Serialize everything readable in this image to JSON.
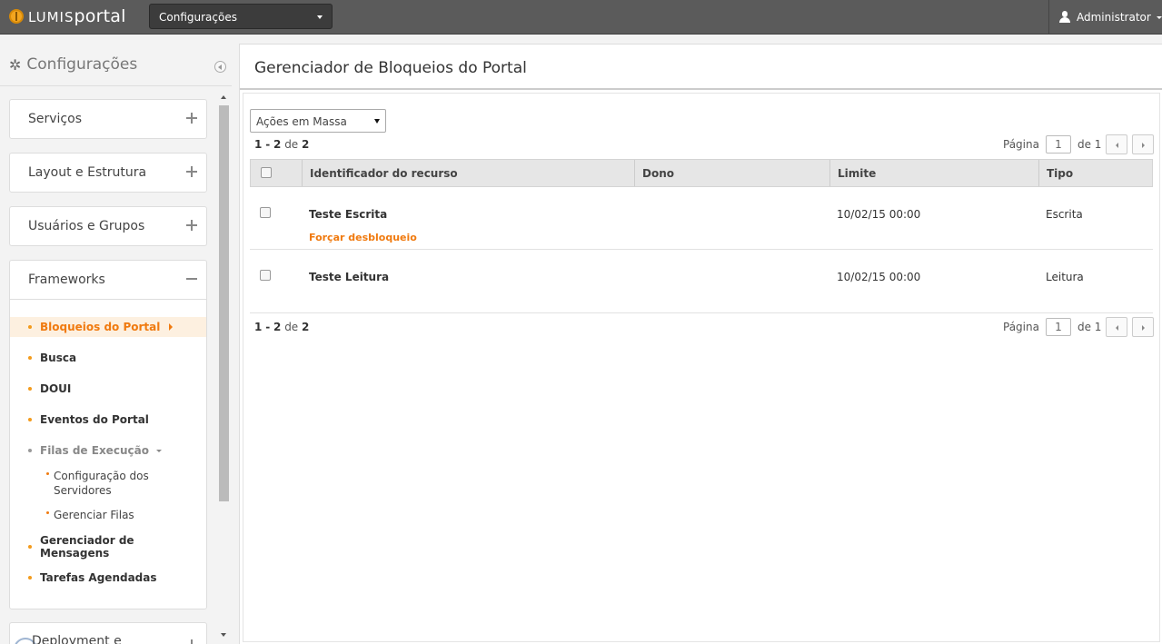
{
  "app": {
    "logo_text_a": "LUMIS",
    "logo_text_b": "portal",
    "context_select": "Configurações",
    "user": "Administrator"
  },
  "sidebar": {
    "title": "Configurações",
    "panels": [
      {
        "label": "Serviços"
      },
      {
        "label": "Layout e Estrutura"
      },
      {
        "label": "Usuários e Grupos"
      }
    ],
    "frameworks": {
      "label": "Frameworks",
      "items": [
        {
          "label": "Bloqueios do Portal"
        },
        {
          "label": "Busca"
        },
        {
          "label": "DOUI"
        },
        {
          "label": "Eventos do Portal"
        },
        {
          "label": "Filas de Execução"
        },
        {
          "label": "Gerenciador de Mensagens"
        },
        {
          "label": "Tarefas Agendadas"
        }
      ],
      "subitems": [
        {
          "label": "Configuração dos Servidores"
        },
        {
          "label": "Gerenciar Filas"
        }
      ]
    },
    "partial_panel": "Deployment e"
  },
  "main": {
    "title": "Gerenciador de Bloqueios do Portal",
    "mass_actions": "Ações em Massa",
    "count": {
      "from": "1",
      "sep": "-",
      "to": "2",
      "of_label": "de",
      "total": "2"
    },
    "pager": {
      "page_label": "Página",
      "page": "1",
      "of_label": "de",
      "pages": "1"
    },
    "columns": [
      "Identificador do recurso",
      "Dono",
      "Limite",
      "Tipo"
    ],
    "rows": [
      {
        "name": "Teste Escrita",
        "owner": "",
        "limit": "10/02/15 00:00",
        "type": "Escrita",
        "action": "Forçar desbloqueio"
      },
      {
        "name": "Teste Leitura",
        "owner": "",
        "limit": "10/02/15 00:00",
        "type": "Leitura"
      }
    ]
  }
}
